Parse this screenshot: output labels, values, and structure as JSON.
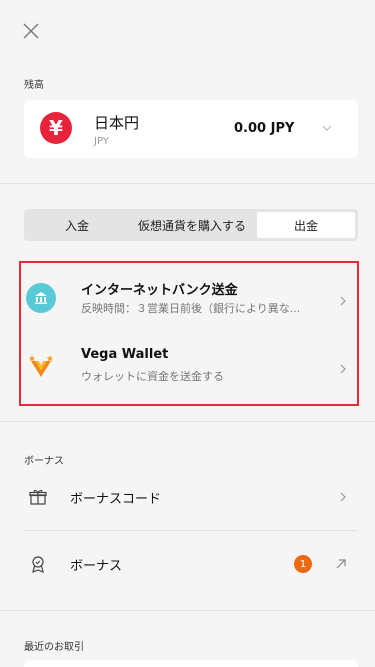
{
  "header": {
    "close_icon": "close-icon"
  },
  "balance": {
    "section_label": "残高",
    "currency_name": "日本円",
    "currency_code": "JPY",
    "currency_symbol": "¥",
    "amount": "0.00 JPY",
    "symbol_color": "#e8243c"
  },
  "tabs": [
    {
      "label": "入金",
      "active": false
    },
    {
      "label": "仮想通貨を購入する",
      "active": false
    },
    {
      "label": "出金",
      "active": true
    }
  ],
  "methods": [
    {
      "title": "インターネットバンク送金",
      "subtitle": "反映時間：３営業日前後（銀行により異な...",
      "icon": "bank-icon"
    },
    {
      "title": "Vega Wallet",
      "subtitle": "ウォレットに資金を送金する",
      "icon": "vega-wallet-icon"
    }
  ],
  "bonus": {
    "section_label": "ボーナス",
    "items": [
      {
        "label": "ボーナスコード",
        "icon": "gift-icon"
      },
      {
        "label": "ボーナス",
        "icon": "medal-icon",
        "badge": "1"
      }
    ]
  },
  "recent": {
    "section_label": "最近のお取引"
  },
  "colors": {
    "highlight": "#e8293a",
    "accent": "#ee6a12",
    "bank": "#59c9d8"
  }
}
